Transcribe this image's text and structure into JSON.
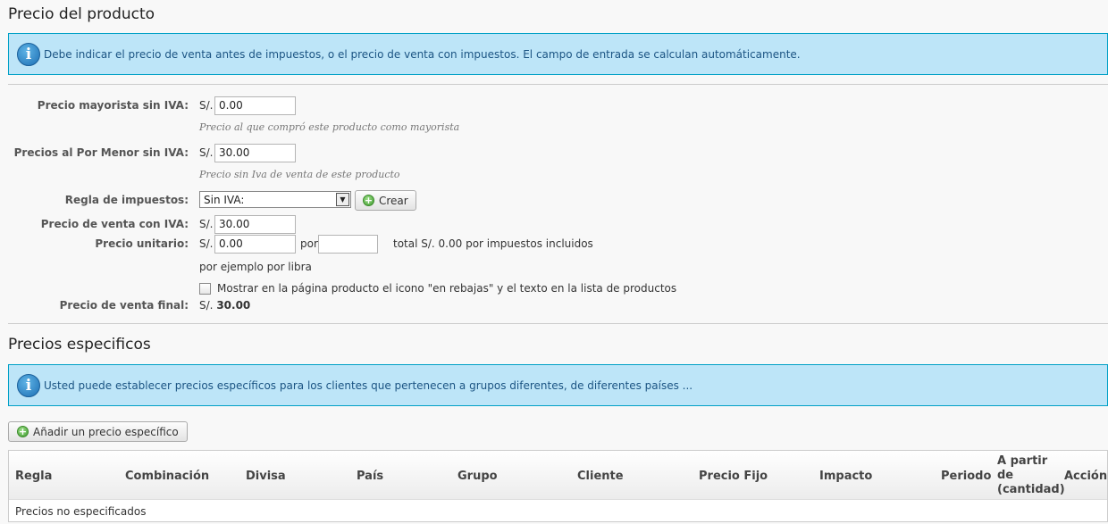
{
  "section1": {
    "title": "Precio del producto",
    "info": "Debe indicar el precio de venta antes de impuestos, o el precio de venta con impuestos. El campo de entrada se calculan automáticamente."
  },
  "currency": "S/.",
  "form": {
    "wholesale_label": "Precio mayorista sin IVA:",
    "wholesale_value": "0.00",
    "wholesale_hint": "Precio al que compró este producto como mayorista",
    "retail_label": "Precios al Por Menor sin IVA:",
    "retail_value": "30.00",
    "retail_hint": "Precio sin Iva de venta de este producto",
    "tax_rule_label": "Regla de impuestos:",
    "tax_rule_value": "Sin IVA:",
    "create_button": "Crear",
    "price_with_tax_label": "Precio de venta con IVA:",
    "price_with_tax_value": "30.00",
    "unit_price_label": "Precio unitario:",
    "unit_price_value": "0.00",
    "unit_per": "por",
    "unit_per_value": "",
    "unit_total": "total S/. 0.00 por impuestos incluidos",
    "unit_example": "por ejemplo por libra",
    "on_sale_label": "Mostrar en la página producto el icono \"en rebajas\" y el texto en la lista de productos",
    "on_sale_checked": false,
    "final_price_label": "Precio de venta final:",
    "final_price_value": "30.00"
  },
  "section2": {
    "title": "Precios especificos",
    "info": "Usted puede establecer precios específicos para los clientes que pertenecen a grupos diferentes, de diferentes países ...",
    "add_button": "Añadir un precio específico"
  },
  "table": {
    "columns": [
      "Regla",
      "Combinación",
      "Divisa",
      "País",
      "Grupo",
      "Cliente",
      "Precio Fijo",
      "Impacto",
      "Periodo",
      "A partir de (cantidad)",
      "Acción"
    ],
    "columns_display": {
      "from_qty_line1": "A partir",
      "from_qty_line2": "de",
      "from_qty_line3": "(cantidad)"
    },
    "empty_message": "Precios no especificados"
  },
  "colors": {
    "info_bg": "#bde5f8",
    "info_border": "#00a0c6",
    "info_text": "#1b5483"
  }
}
